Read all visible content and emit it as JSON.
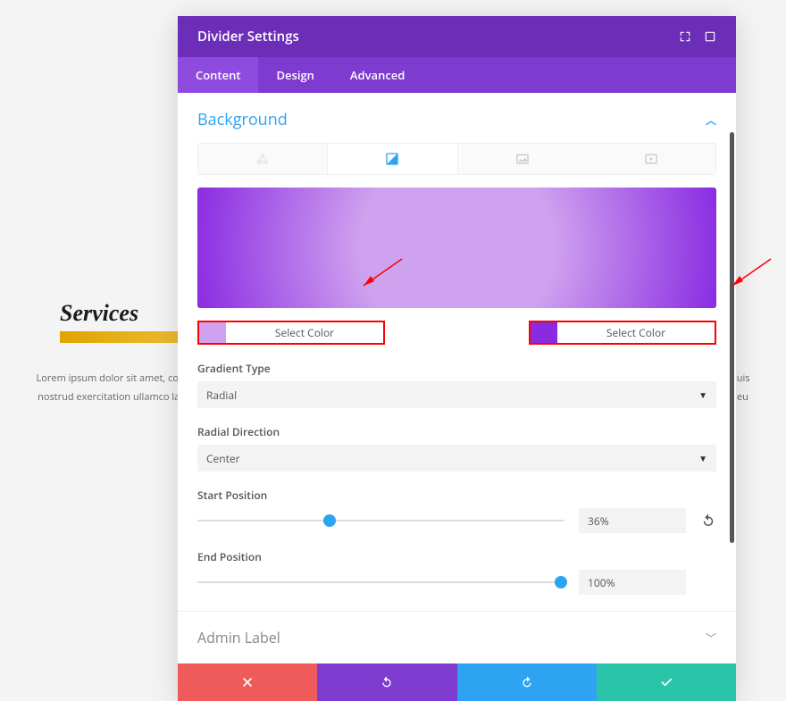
{
  "background_page": {
    "heading": "Services",
    "body": "Lorem ipsum dolor sit amet, consectetur adipiscing elit, sed do eiusmod tempor incididunt ut labore et dolore magna aliqua. Ut enim ad minim veniam, quis nostrud exercitation ullamco laboris nisi ut aliquip ex ea commodo consequat. Duis aute irure dolor in reprehenderit in voluptate velit esse cillum dolore eu fugiat nulla pariatur."
  },
  "modal": {
    "title": "Divider Settings",
    "tabs": [
      "Content",
      "Design",
      "Advanced"
    ],
    "active_tab": 0,
    "section_title": "Background",
    "color1_label": "Select Color",
    "color2_label": "Select Color",
    "color1_hex": "#cfa2ef",
    "color2_hex": "#8a2be2",
    "gradient_type_label": "Gradient Type",
    "gradient_type_value": "Radial",
    "radial_direction_label": "Radial Direction",
    "radial_direction_value": "Center",
    "start_position_label": "Start Position",
    "start_position_value": "36%",
    "start_position_pct": 36,
    "end_position_label": "End Position",
    "end_position_value": "100%",
    "end_position_pct": 100,
    "section2_title": "Admin Label"
  }
}
